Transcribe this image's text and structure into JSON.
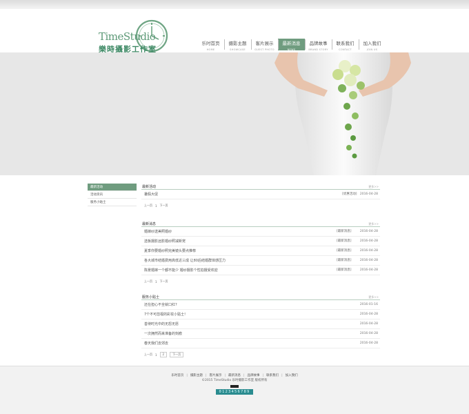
{
  "logo": {
    "en": "TimeStudio",
    "cn": "樂時攝影工作室"
  },
  "nav": [
    {
      "zh": "乐时首页",
      "en": "HOME"
    },
    {
      "zh": "摄影主题",
      "en": "SHOWCASE"
    },
    {
      "zh": "客片展示",
      "en": "GUEST PHOTO"
    },
    {
      "zh": "最新消息",
      "en": "NEWS"
    },
    {
      "zh": "品牌故事",
      "en": "BRAND STORY"
    },
    {
      "zh": "联系我们",
      "en": "CONTACT"
    },
    {
      "zh": "加入我们",
      "en": "JOIN US"
    }
  ],
  "nav_active_index": 3,
  "sidebar": {
    "items": [
      "最新活动",
      "活动资讯",
      "服务小贴士"
    ]
  },
  "sections": [
    {
      "title": "最新活动",
      "more": "更多>>",
      "rows": [
        {
          "title": "暑假大促",
          "category": "[优惠活动]",
          "date": "2016-04-28"
        }
      ],
      "pager": {
        "prev": "上一页",
        "page": "1",
        "next": "下一页"
      }
    },
    {
      "title": "最新消息",
      "more": "更多>>",
      "rows": [
        {
          "title": "婚嫁纱送美照婚纱",
          "category": "[最新消息]",
          "date": "2016-04-28"
        },
        {
          "title": "选板摄影远影婚纱照减新宠",
          "category": "[最新消息]",
          "date": "2016-04-28"
        },
        {
          "title": "夏季你要婚纱照完美镜头要点推荐",
          "category": "[最新消息]",
          "date": "2016-04-28"
        },
        {
          "title": "各大城市结婚费用高低近三成 让80后结婚群体感压力",
          "category": "[最新消息]",
          "date": "2016-04-28"
        },
        {
          "title": "陈景婚嫁一个都不能少 婚纱摄影个性拍摄受欢迎",
          "category": "[最新消息]",
          "date": "2016-04-28"
        }
      ],
      "pager": {
        "prev": "上一页",
        "page": "1",
        "next": "下一页"
      }
    },
    {
      "title": "服务小贴士",
      "more": "更多>>",
      "rows": [
        {
          "title": "还在担心不全就口红?",
          "date": "2016-01-16"
        },
        {
          "title": "7个不可忽视的彩妆小贴士!",
          "date": "2016-04-28"
        },
        {
          "title": "善待时光中的无怨无愿",
          "date": "2016-04-28"
        },
        {
          "title": "一次拥然而来准备的刻痕",
          "date": "2016-04-28"
        },
        {
          "title": "春天我们去郊去",
          "date": "2016-04-28"
        }
      ],
      "pager": {
        "prev": "上一页",
        "page": "1",
        "page2": "2",
        "next": "下一页"
      }
    }
  ],
  "footer": {
    "links": [
      "乐时首页",
      "摄影主题",
      "客片展示",
      "最新消息",
      "品牌故事",
      "联系我们",
      "加入我们"
    ],
    "separator": "|",
    "copyright": "©2015  TimeStudio  乐时摄影工作室  版权所有",
    "counter": "0123456789"
  },
  "colors": {
    "accent": "#6f9c7f",
    "counter_bg": "#2a8b8f"
  }
}
